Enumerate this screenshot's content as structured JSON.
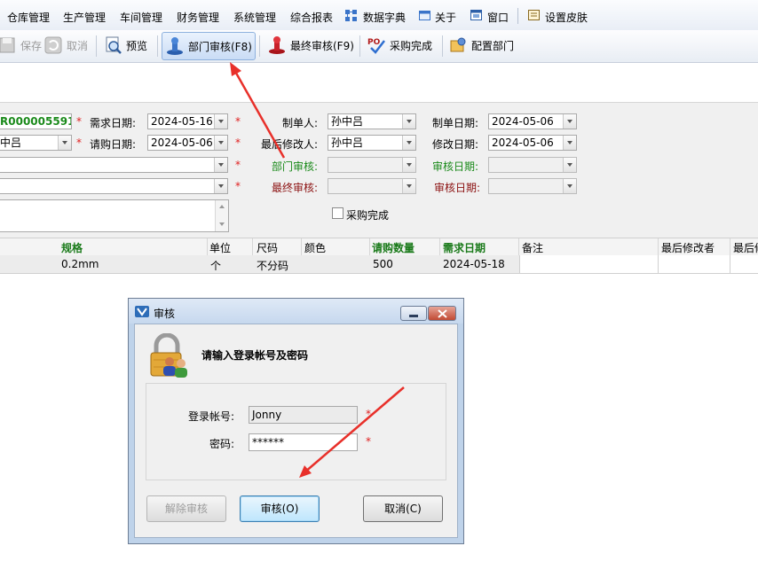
{
  "menubar": {
    "items": [
      "仓库管理",
      "生产管理",
      "车间管理",
      "财务管理",
      "系统管理",
      "综合报表",
      "数据字典",
      "关于",
      "窗口",
      "设置皮肤"
    ]
  },
  "toolbar": {
    "save": "保存",
    "cancel": "取消",
    "preview": "预览",
    "dept_audit": "部门审核(F8)",
    "final_audit": "最终审核(F9)",
    "purchase_done": "采购完成",
    "config_dept": "配置部门"
  },
  "form": {
    "order_no": "R000005591",
    "demand_date_label": "需求日期:",
    "demand_date": "2024-05-16",
    "maker_label": "制单人:",
    "maker": "孙中吕",
    "make_date_label": "制单日期:",
    "make_date": "2024-05-06",
    "requester": "中吕",
    "request_date_label": "请购日期:",
    "request_date": "2024-05-06",
    "last_modifier_label": "最后修改人:",
    "last_modifier": "孙中吕",
    "modify_date_label": "修改日期:",
    "modify_date": "2024-05-06",
    "dept_audit_label": "部门审核:",
    "audit_date_label_1": "审核日期:",
    "final_audit_label": "最终审核:",
    "audit_date_label_2": "审核日期:",
    "purchase_complete_label": "采购完成",
    "required_mark": "*"
  },
  "grid": {
    "headers": [
      "规格",
      "单位",
      "尺码",
      "颜色",
      "请购数量",
      "需求日期",
      "备注",
      "最后修改者",
      "最后修"
    ],
    "row": [
      "0.2mm",
      "个",
      "不分码",
      "",
      "500",
      "2024-05-18",
      "",
      "",
      ""
    ]
  },
  "dialog": {
    "title": "审核",
    "prompt": "请输入登录帐号及密码",
    "account_label": "登录帐号:",
    "account_value": "Jonny",
    "password_label": "密码:",
    "password_value": "******",
    "unaudit_button": "解除审核",
    "audit_button": "审核(O)",
    "cancel_button": "取消(C)",
    "required_mark": "*"
  },
  "colors": {
    "arrow": "#e8302a",
    "accent_green": "#1a8a1a",
    "accent_darkred": "#8b1010"
  }
}
